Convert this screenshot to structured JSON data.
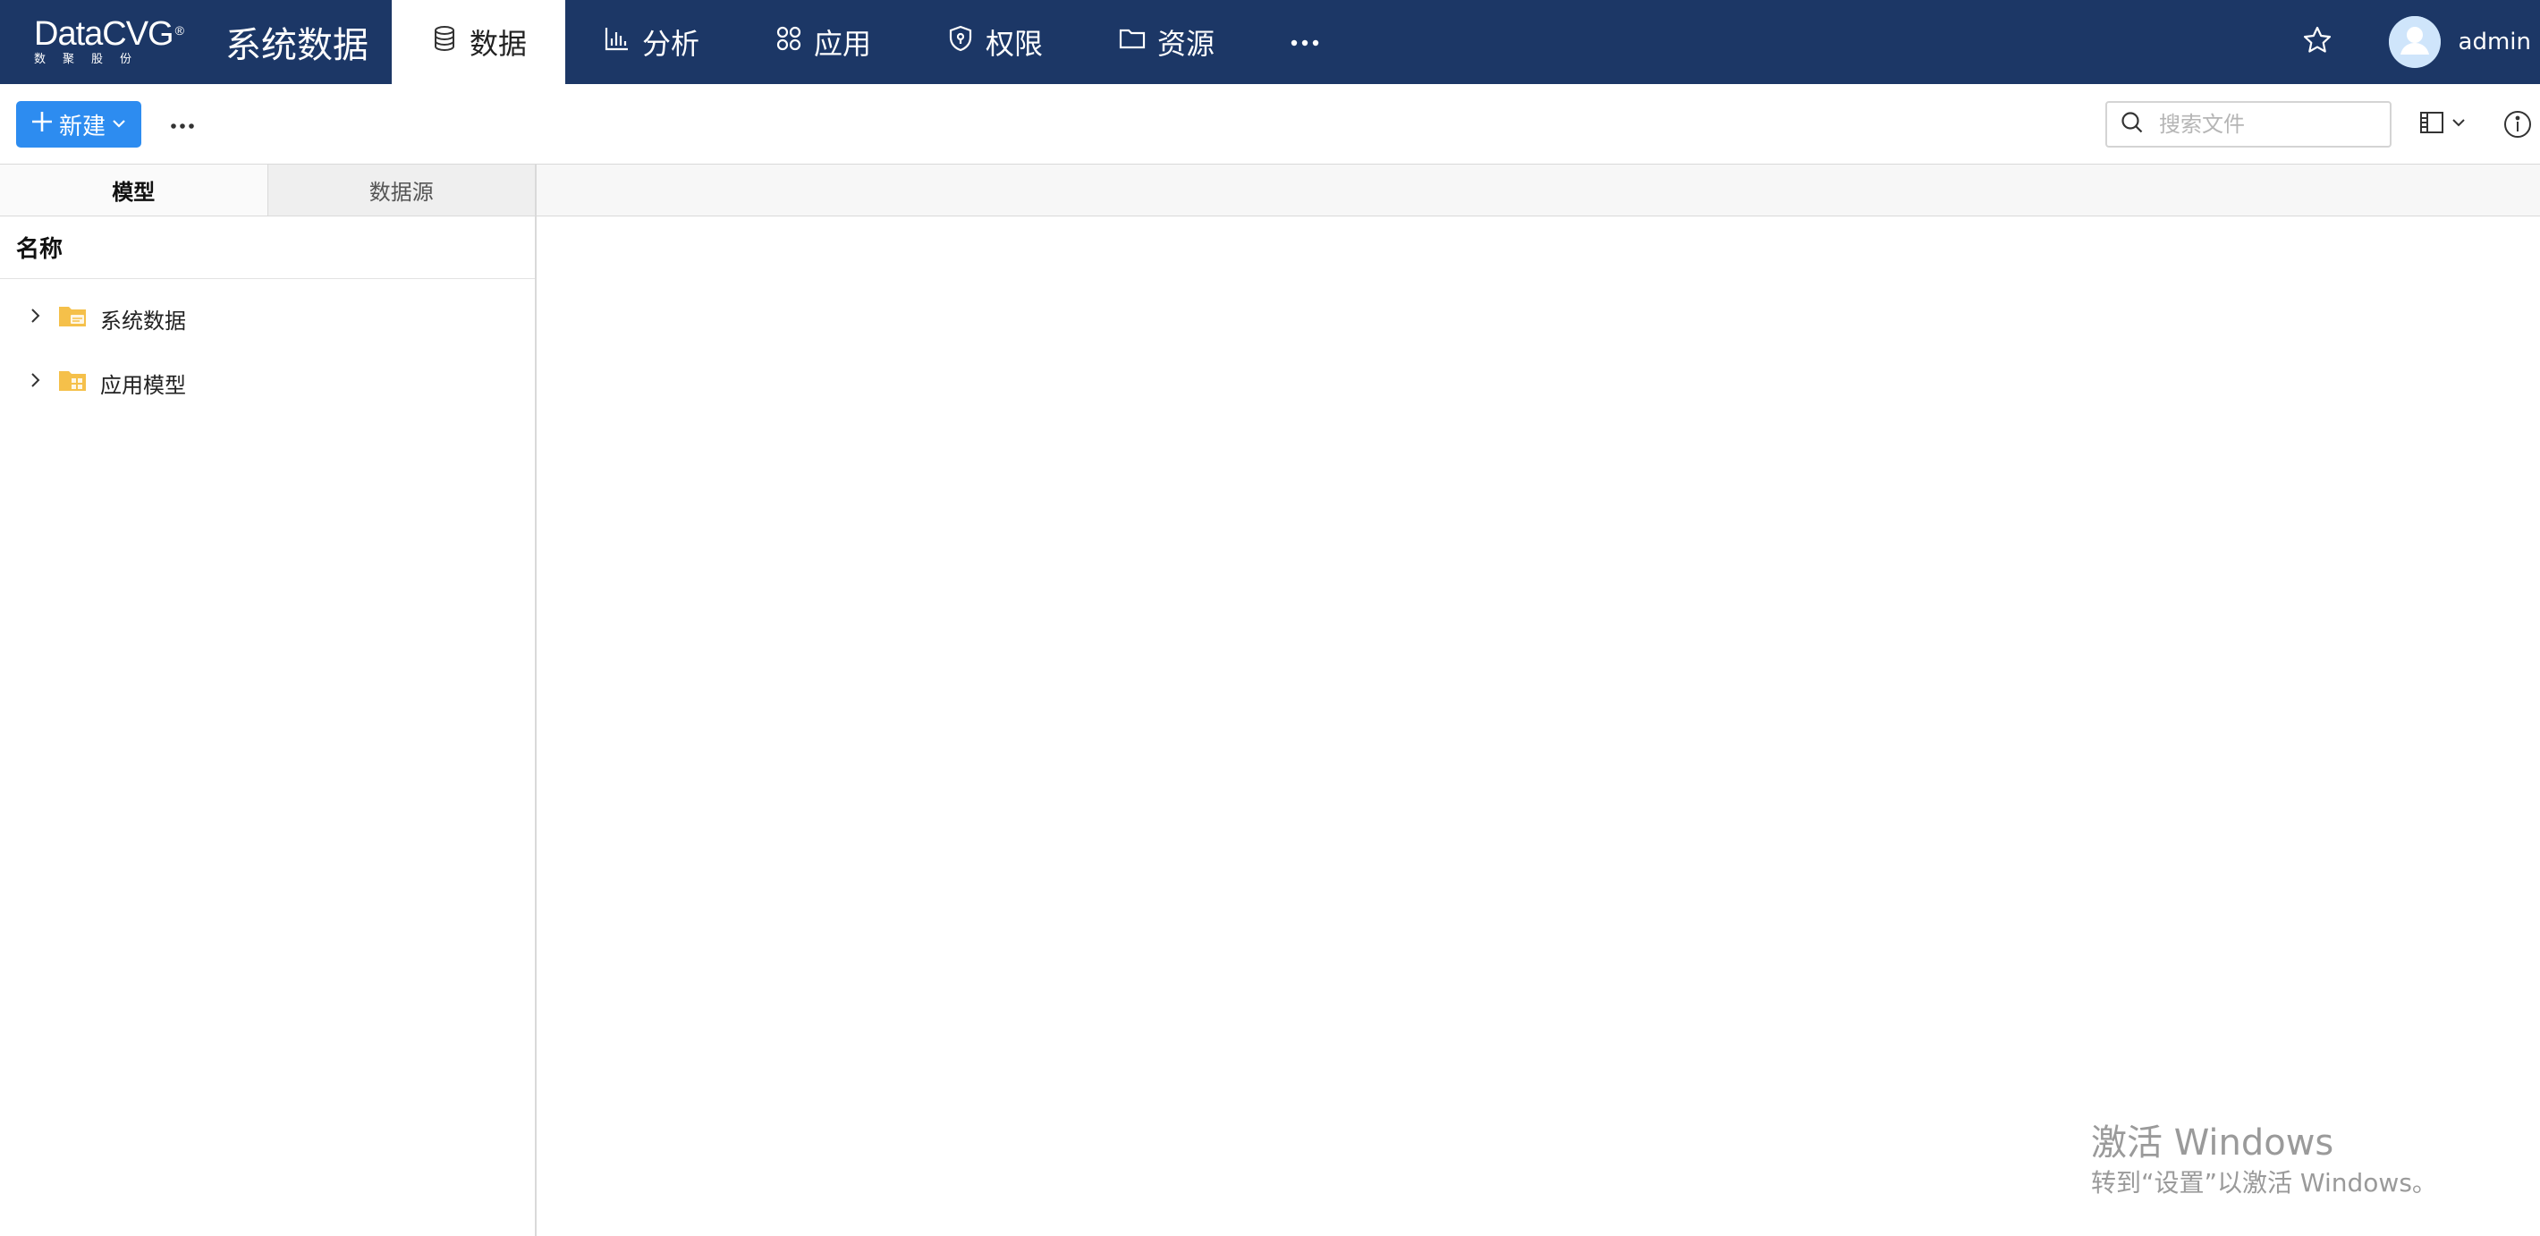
{
  "brand": {
    "logo_text": "DataCVG",
    "logo_reg": "®",
    "logo_sub": "数聚股份",
    "app_title": "系统数据"
  },
  "nav": {
    "tabs": [
      {
        "label": "数据",
        "icon": "database-icon",
        "active": true
      },
      {
        "label": "分析",
        "icon": "bar-chart-icon",
        "active": false
      },
      {
        "label": "应用",
        "icon": "apps-icon",
        "active": false
      },
      {
        "label": "权限",
        "icon": "shield-icon",
        "active": false
      },
      {
        "label": "资源",
        "icon": "folder-icon",
        "active": false
      }
    ],
    "more_icon": "more-icon"
  },
  "user": {
    "name": "admin",
    "favorite_icon": "star-icon",
    "avatar_icon": "user-avatar-icon"
  },
  "toolbar": {
    "new_label": "新建",
    "search_placeholder": "搜索文件",
    "search_value": ""
  },
  "left_panel": {
    "tabs": [
      {
        "label": "模型",
        "active": true
      },
      {
        "label": "数据源",
        "active": false
      }
    ],
    "column_header": "名称",
    "tree": [
      {
        "label": "系统数据",
        "icon": "system-folder-icon",
        "expanded": false
      },
      {
        "label": "应用模型",
        "icon": "app-folder-icon",
        "expanded": false
      }
    ]
  },
  "watermark": {
    "title": "激活 Windows",
    "subtitle": "转到“设置”以激活 Windows。"
  },
  "colors": {
    "topbar": "#1c3766",
    "primary": "#2d8cf0",
    "folder": "#f5c04a"
  }
}
